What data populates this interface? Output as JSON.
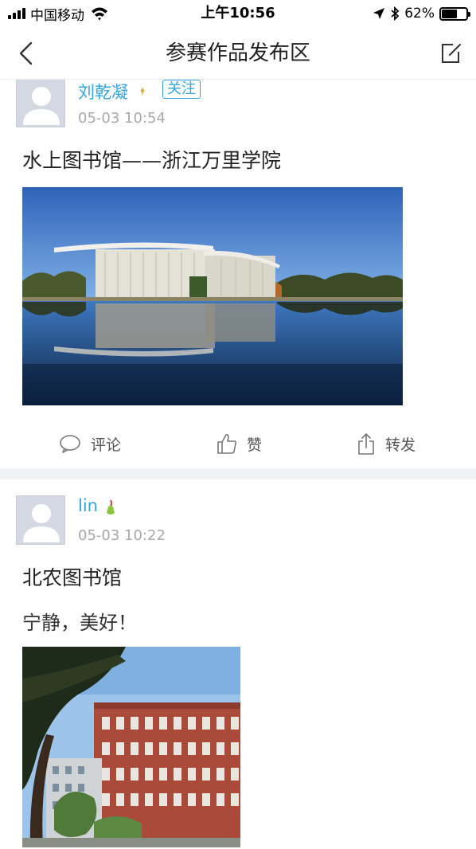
{
  "status_bar": {
    "carrier": "中国移动",
    "time": "上午10:56",
    "battery_percent": "62%",
    "battery_level": 0.62
  },
  "nav": {
    "title": "参赛作品发布区"
  },
  "posts": [
    {
      "username": "刘乾凝",
      "follow_label": "关注",
      "timestamp": "05-03 10:54",
      "title": "水上图书馆——浙江万里学院",
      "actions": {
        "comment": "评论",
        "like": "赞",
        "share": "转发"
      }
    },
    {
      "username": "lin",
      "timestamp": "05-03 10:22",
      "title": "北农图书馆",
      "text": "宁静，美好！"
    }
  ],
  "colors": {
    "link_blue": "#35a4dd",
    "timestamp_gray": "#a9a9a9",
    "separator": "#f1f2f6"
  }
}
